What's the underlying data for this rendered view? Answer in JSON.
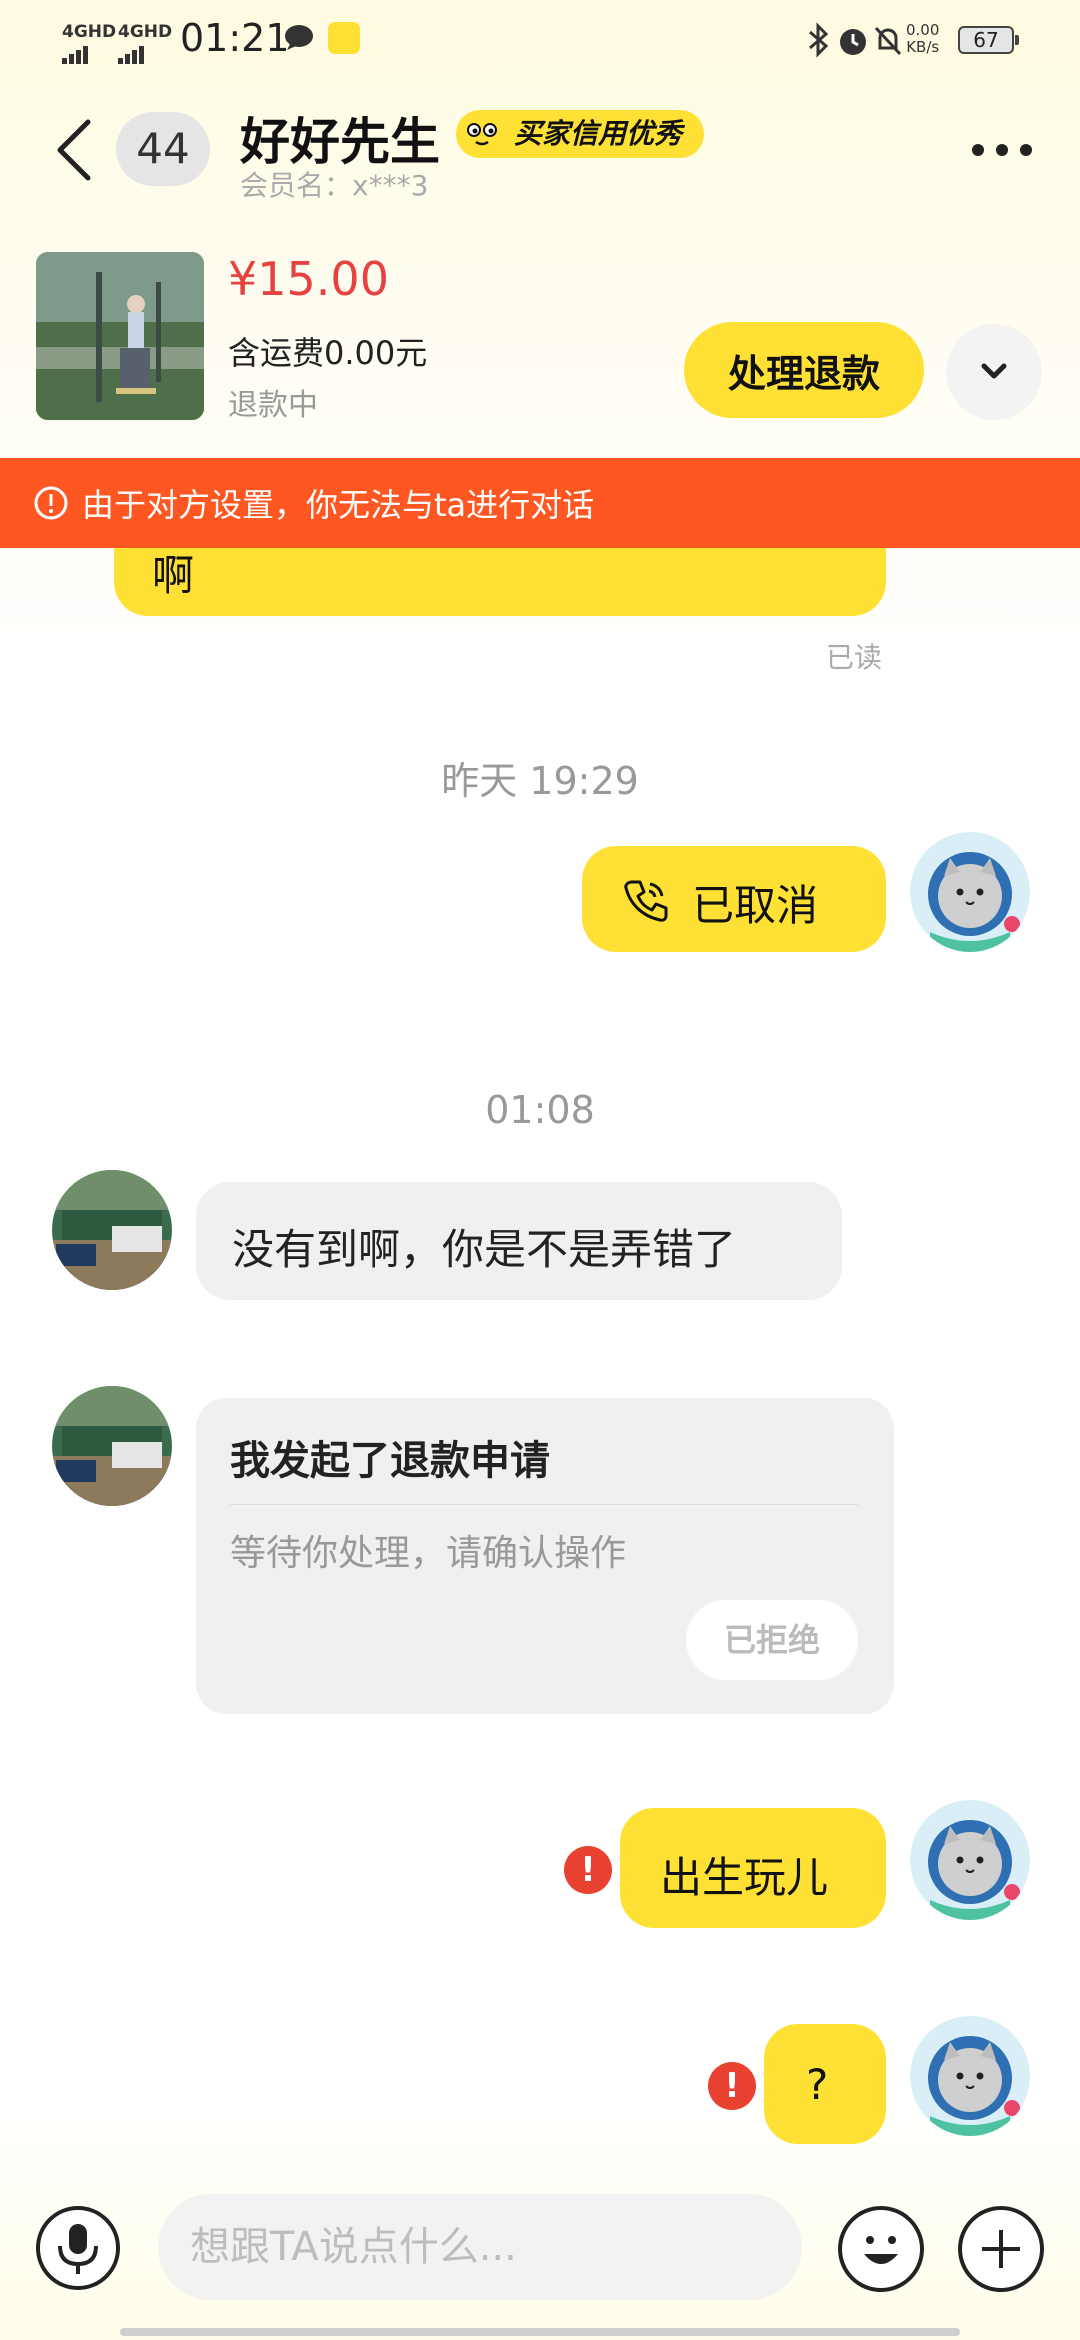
{
  "status_bar": {
    "signal_1": "4GHD",
    "signal_2": "4GHD",
    "time": "01:21",
    "net_speed_value": "0.00",
    "net_speed_unit": "KB/s",
    "battery": "67"
  },
  "header": {
    "unread_count": "44",
    "user_name": "好好先生",
    "credit_badge": "买家信用优秀",
    "member_name": "会员名：x***3"
  },
  "order": {
    "price": "¥15.00",
    "shipping": "含运费0.00元",
    "status": "退款中",
    "refund_button": "处理退款"
  },
  "warning": {
    "text": "由于对方设置，你无法与ta进行对话"
  },
  "messages": {
    "partial_text": "啊",
    "read_label": "已读",
    "timestamp_1": "昨天 19:29",
    "call_status": "已取消",
    "timestamp_2": "01:08",
    "incoming_1": "没有到啊，你是不是弄错了",
    "refund_card": {
      "title": "我发起了退款申请",
      "subtitle": "等待你处理，请确认操作",
      "action": "已拒绝"
    },
    "outgoing_1": "出生玩儿",
    "outgoing_2": "?",
    "error_mark": "!"
  },
  "input": {
    "placeholder": "想跟TA说点什么..."
  },
  "colors": {
    "accent_yellow": "#ffe135",
    "warning_orange": "#ff5722",
    "price_red": "#e64340",
    "error_red": "#e8412f"
  },
  "icons": [
    "back-icon",
    "more-icon",
    "chevron-down-icon",
    "warning-icon",
    "phone-icon",
    "error-icon",
    "microphone-icon",
    "emoji-icon",
    "plus-icon"
  ]
}
